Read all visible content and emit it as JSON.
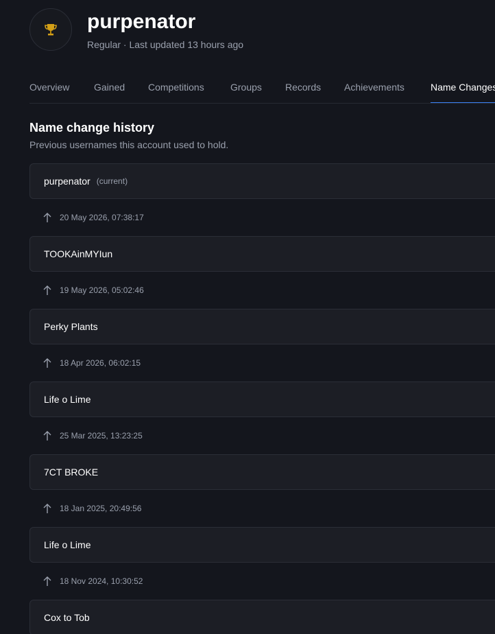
{
  "player": {
    "name": "purpenator",
    "meta": "Regular · Last updated 13 hours ago",
    "avatar_icon": "trophy-icon"
  },
  "tabs": [
    {
      "label": "Overview",
      "active": false
    },
    {
      "label": "Gained",
      "active": false
    },
    {
      "label": "Competitions",
      "active": false
    },
    {
      "label": "Groups",
      "active": false
    },
    {
      "label": "Records",
      "active": false
    },
    {
      "label": "Achievements",
      "active": false
    },
    {
      "label": "Name Changes",
      "active": true
    }
  ],
  "section": {
    "title": "Name change history",
    "subtitle": "Previous usernames this account used to hold."
  },
  "history": {
    "current_tag": "(current)",
    "names": [
      "purpenator",
      "TOOKAinMYIun",
      "Perky Plants",
      "Life o Lime",
      "7CT BROKE",
      "Life o Lime",
      "Cox to Tob"
    ],
    "dates": [
      "20 May 2026, 07:38:17",
      "19 May 2026, 05:02:46",
      "18 Apr 2026, 06:02:15",
      "25 Mar 2025, 13:23:25",
      "18 Jan 2025, 20:49:56",
      "18 Nov 2024, 10:30:52"
    ]
  },
  "colors": {
    "background": "#14161d",
    "card": "#1c1e25",
    "border": "#2b2e37",
    "muted_text": "#9aa0ad",
    "accent": "#3b82f6",
    "trophy": "#d4a017"
  }
}
